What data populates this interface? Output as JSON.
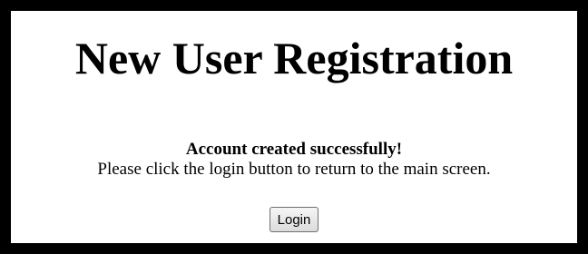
{
  "page": {
    "title": "New User Registration",
    "success_message": "Account created successfully!",
    "instruction": "Please click the login button to return to the main screen.",
    "login_label": "Login"
  },
  "colors": {
    "border": "#000000",
    "background": "#ffffff"
  }
}
